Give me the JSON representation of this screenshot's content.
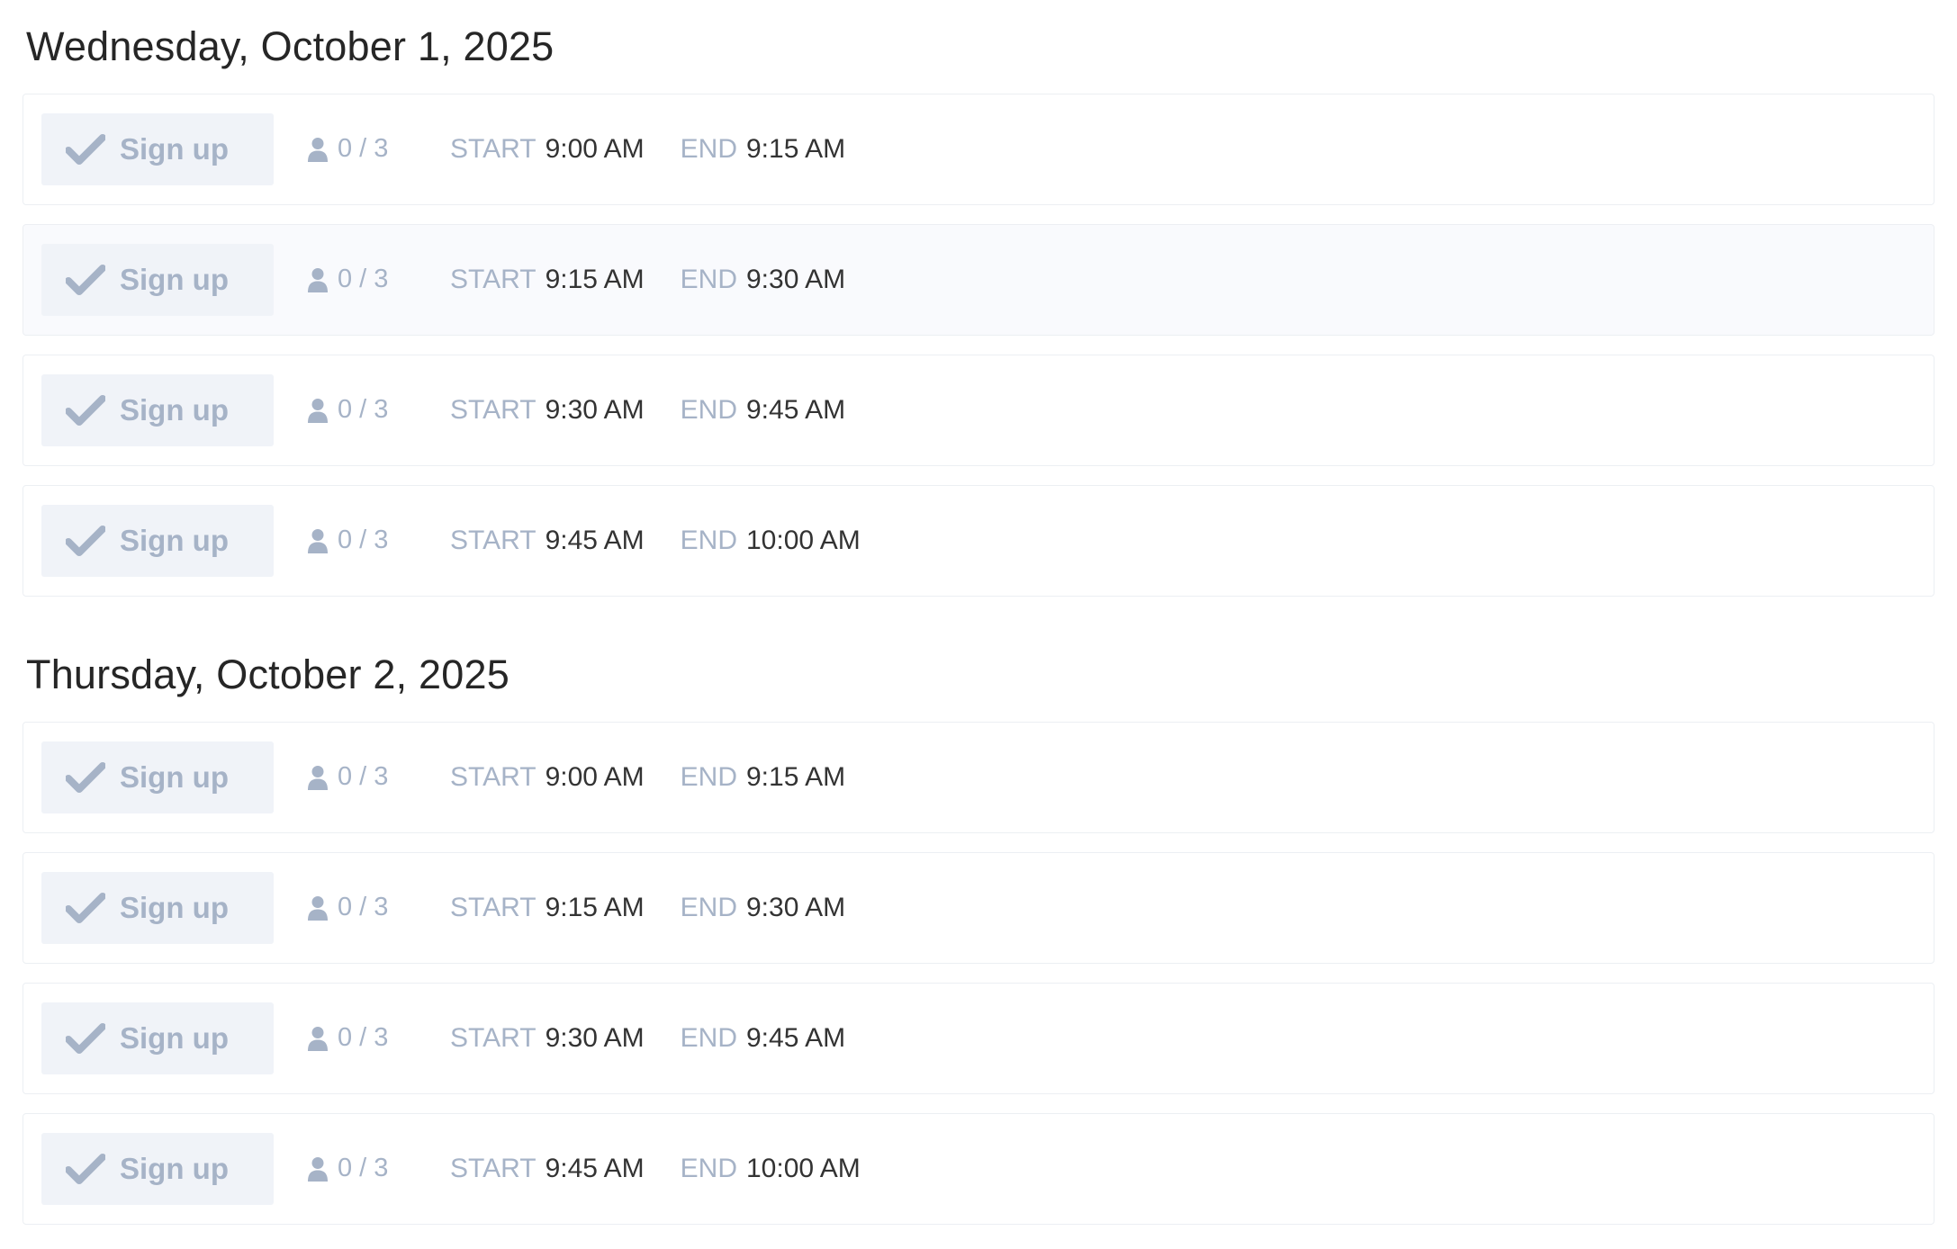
{
  "days": [
    {
      "title": "Wednesday, October 1, 2025",
      "slots": [
        {
          "button_label": "Sign up",
          "capacity": "0 / 3",
          "start_label": "START",
          "start": "9:00 AM",
          "end_label": "END",
          "end": "9:15 AM"
        },
        {
          "button_label": "Sign up",
          "capacity": "0 / 3",
          "start_label": "START",
          "start": "9:15 AM",
          "end_label": "END",
          "end": "9:30 AM"
        },
        {
          "button_label": "Sign up",
          "capacity": "0 / 3",
          "start_label": "START",
          "start": "9:30 AM",
          "end_label": "END",
          "end": "9:45 AM"
        },
        {
          "button_label": "Sign up",
          "capacity": "0 / 3",
          "start_label": "START",
          "start": "9:45 AM",
          "end_label": "END",
          "end": "10:00 AM"
        }
      ]
    },
    {
      "title": "Thursday, October 2, 2025",
      "slots": [
        {
          "button_label": "Sign up",
          "capacity": "0 / 3",
          "start_label": "START",
          "start": "9:00 AM",
          "end_label": "END",
          "end": "9:15 AM"
        },
        {
          "button_label": "Sign up",
          "capacity": "0 / 3",
          "start_label": "START",
          "start": "9:15 AM",
          "end_label": "END",
          "end": "9:30 AM"
        },
        {
          "button_label": "Sign up",
          "capacity": "0 / 3",
          "start_label": "START",
          "start": "9:30 AM",
          "end_label": "END",
          "end": "9:45 AM"
        },
        {
          "button_label": "Sign up",
          "capacity": "0 / 3",
          "start_label": "START",
          "start": "9:45 AM",
          "end_label": "END",
          "end": "10:00 AM"
        }
      ]
    }
  ],
  "icons": {
    "button_icon": "check-icon",
    "capacity_icon": "user-icon"
  },
  "colors": {
    "muted_text": "#a6b3c7",
    "button_background": "#f0f3f8",
    "row_border": "#eceff3",
    "hovered_row_background": "#f9fafd",
    "heading_text": "#262626",
    "time_text": "#333333"
  }
}
